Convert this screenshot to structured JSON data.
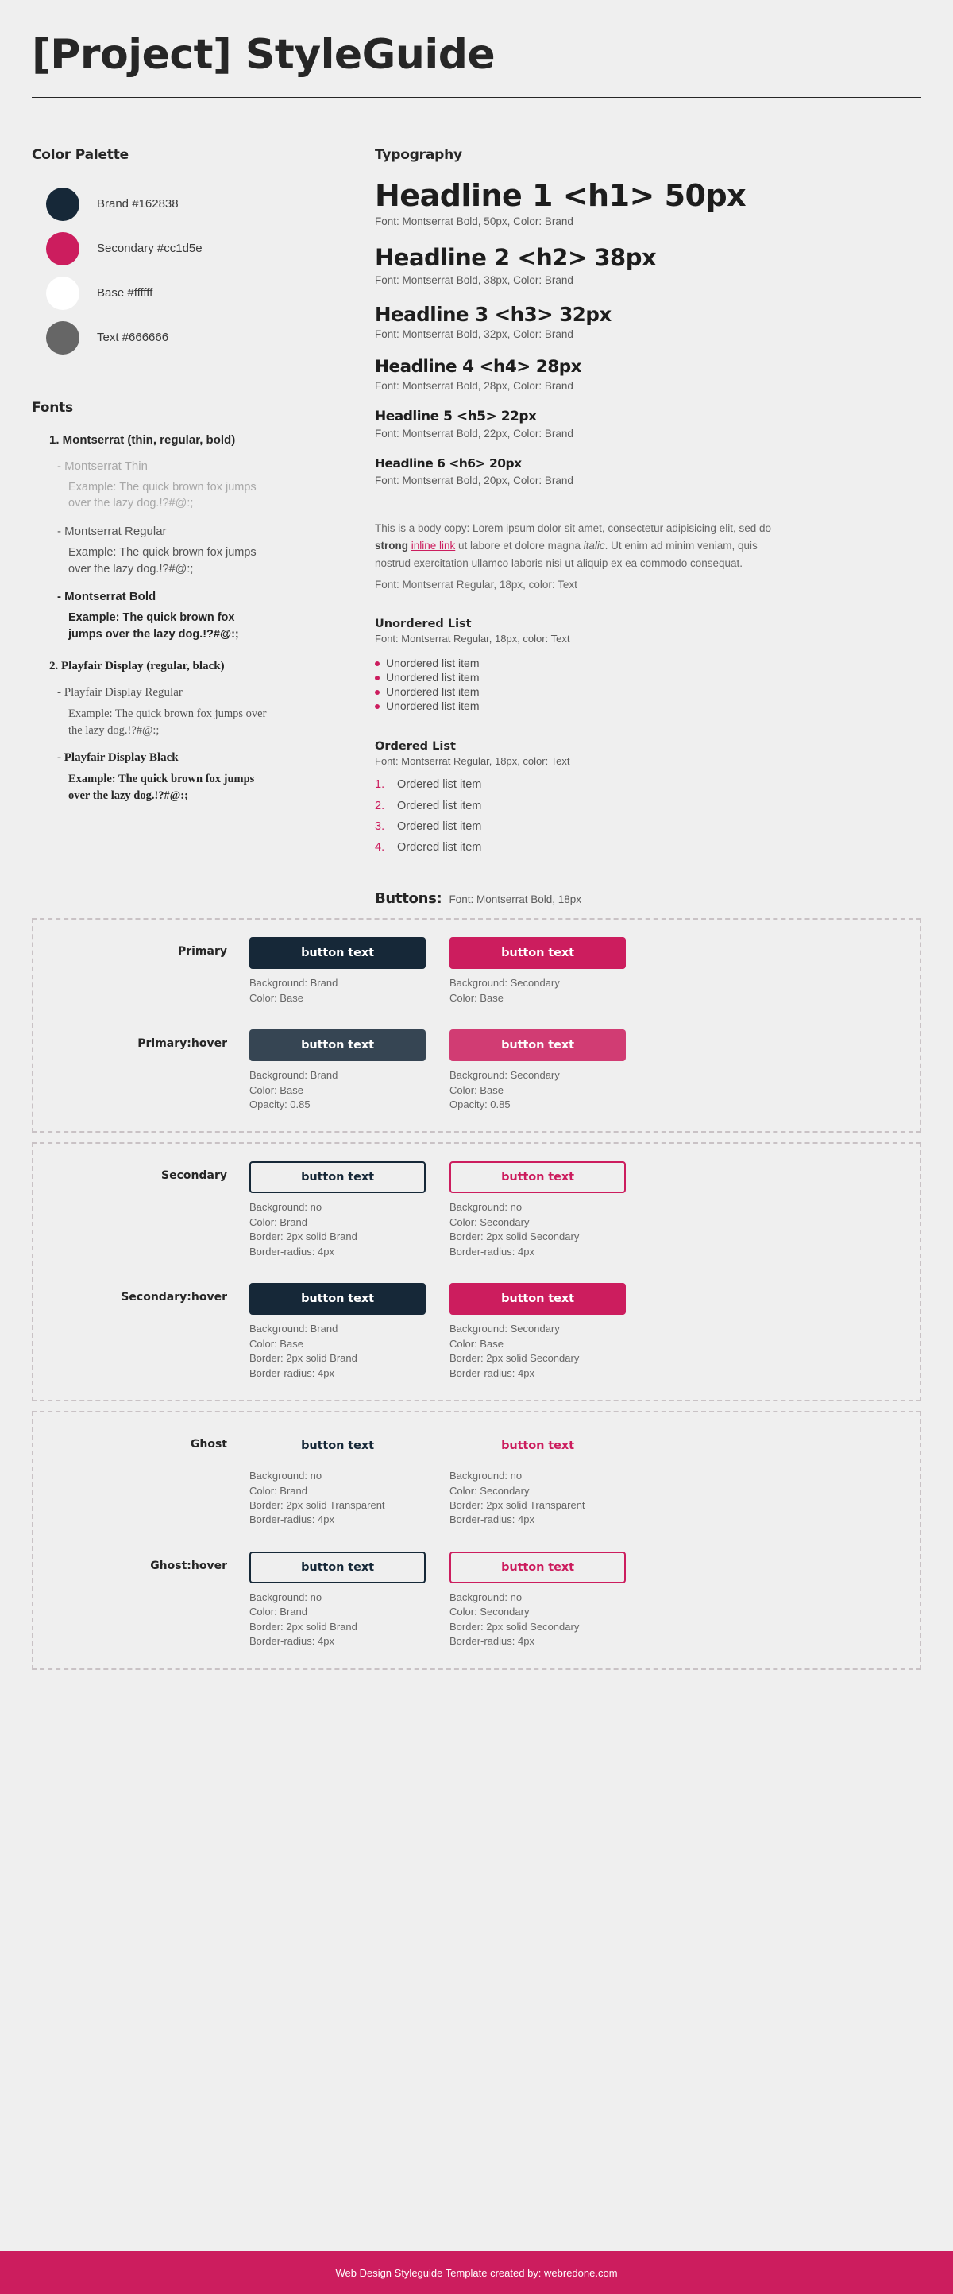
{
  "header": {
    "title": "[Project] StyleGuide"
  },
  "palette": {
    "section_title": "Color Palette",
    "swatches": [
      {
        "name": "Brand #162838",
        "hex": "#162838",
        "border": false
      },
      {
        "name": "Secondary #cc1d5e",
        "hex": "#cc1d5e",
        "border": false
      },
      {
        "name": "Base #ffffff",
        "hex": "#ffffff",
        "border": false
      },
      {
        "name": "Text #666666",
        "hex": "#666666",
        "border": false
      }
    ]
  },
  "fonts": {
    "section_title": "Fonts",
    "groups": [
      {
        "title": "1. Montserrat (thin, regular, bold)",
        "family": "mont",
        "variants": [
          {
            "name": "- Montserrat Thin",
            "style": "thin",
            "sample": "Example: The quick brown fox jumps over the lazy dog.!?#@:;"
          },
          {
            "name": "- Montserrat Regular",
            "style": "regular",
            "sample": "Example: The quick brown fox jumps over the lazy dog.!?#@:;"
          },
          {
            "name": "- Montserrat Bold",
            "style": "bold",
            "sample": "Example: The quick brown fox jumps over the lazy dog.!?#@:;"
          }
        ]
      },
      {
        "title": "2. Playfair Display (regular, black)",
        "family": "play",
        "variants": [
          {
            "name": "- Playfair Display Regular",
            "style": "playreg",
            "sample": "Example: The quick brown fox jumps over the lazy dog.!?#@:;"
          },
          {
            "name": "- Playfair Display Black",
            "style": "playblk",
            "sample": "Example: The quick brown fox jumps over the lazy dog.!?#@:;"
          }
        ]
      }
    ]
  },
  "typography": {
    "section_title": "Typography",
    "headlines": [
      {
        "text": "Headline 1 <h1> 50px",
        "meta": "Font: Montserrat Bold, 50px, Color: Brand",
        "cls": "hl1"
      },
      {
        "text": "Headline 2 <h2> 38px",
        "meta": "Font: Montserrat Bold, 38px, Color: Brand",
        "cls": "hl2"
      },
      {
        "text": "Headline 3 <h3> 32px",
        "meta": "Font: Montserrat Bold, 32px, Color: Brand",
        "cls": "hl3"
      },
      {
        "text": "Headline 4 <h4> 28px",
        "meta": "Font: Montserrat Bold, 28px, Color: Brand",
        "cls": "hl4"
      },
      {
        "text": "Headline 5 <h5> 22px",
        "meta": "Font: Montserrat Bold, 22px, Color: Brand",
        "cls": "hl5"
      },
      {
        "text": "Headline 6 <h6> 20px",
        "meta": "Font: Montserrat Bold, 20px, Color: Brand",
        "cls": "hl6"
      }
    ],
    "body_copy": {
      "part1": "This is a body copy: Lorem ipsum dolor sit amet, consectetur adipisicing elit, sed do ",
      "strong": "strong",
      "space1": " ",
      "link": "inline link",
      "part2": " ut labore et dolore magna ",
      "italic": "italic",
      "part3": ". Ut enim ad minim veniam, quis nostrud exercitation ullamco laboris nisi ut aliquip ex ea commodo consequat.",
      "meta": "Font: Montserrat Regular, 18px, color: Text"
    },
    "unordered": {
      "head": "Unordered List",
      "meta": "Font: Montserrat Regular, 18px, color: Text",
      "items": [
        "Unordered list item",
        "Unordered list item",
        "Unordered list item",
        "Unordered list item"
      ]
    },
    "ordered": {
      "head": "Ordered List",
      "meta": "Font: Montserrat Regular, 18px, color: Text",
      "items": [
        "Ordered list item",
        "Ordered list item",
        "Ordered list item",
        "Ordered list item"
      ]
    }
  },
  "buttons": {
    "title": "Buttons:",
    "meta": "Font: Montserrat Bold, 18px",
    "label": "button text",
    "groups": [
      {
        "rows": [
          {
            "label": "Primary",
            "cells": [
              {
                "style": "btn-fill-brand",
                "spec": "Background: Brand\nColor: Base"
              },
              {
                "style": "btn-fill-secondary",
                "spec": "Background: Secondary\nColor: Base"
              }
            ]
          },
          {
            "label": "Primary:hover",
            "cells": [
              {
                "style": "btn-fill-brand-h",
                "spec": "Background: Brand\nColor: Base\nOpacity: 0.85"
              },
              {
                "style": "btn-fill-secondary-h",
                "spec": "Background: Secondary\nColor: Base\nOpacity: 0.85"
              }
            ]
          }
        ]
      },
      {
        "rows": [
          {
            "label": "Secondary",
            "cells": [
              {
                "style": "btn-outline-brand",
                "spec": "Background: no\nColor: Brand\nBorder: 2px solid Brand\nBorder-radius: 4px"
              },
              {
                "style": "btn-outline-secondary",
                "spec": "Background: no\nColor: Secondary\nBorder: 2px solid Secondary\nBorder-radius: 4px"
              }
            ]
          },
          {
            "label": "Secondary:hover",
            "cells": [
              {
                "style": "btn-fill-brand",
                "spec": "Background: Brand\nColor: Base\nBorder: 2px solid Brand\nBorder-radius: 4px"
              },
              {
                "style": "btn-fill-secondary",
                "spec": "Background: Secondary\nColor: Base\nBorder: 2px solid Secondary\nBorder-radius: 4px"
              }
            ]
          }
        ]
      },
      {
        "rows": [
          {
            "label": "Ghost",
            "cells": [
              {
                "style": "btn-ghost-brand",
                "spec": "Background: no\nColor: Brand\nBorder: 2px solid Transparent\nBorder-radius: 4px"
              },
              {
                "style": "btn-ghost-secondary",
                "spec": "Background: no\nColor: Secondary\nBorder: 2px solid Transparent\nBorder-radius: 4px"
              }
            ]
          },
          {
            "label": "Ghost:hover",
            "cells": [
              {
                "style": "btn-outline-brand",
                "spec": "Background: no\nColor: Brand\nBorder: 2px solid Brand\nBorder-radius: 4px"
              },
              {
                "style": "btn-outline-secondary",
                "spec": "Background: no\nColor: Secondary\nBorder: 2px solid Secondary\nBorder-radius: 4px"
              }
            ]
          }
        ]
      }
    ]
  },
  "footer": {
    "text": "Web Design Styleguide Template created by: webredone.com",
    "background": "#cc1d5e"
  }
}
